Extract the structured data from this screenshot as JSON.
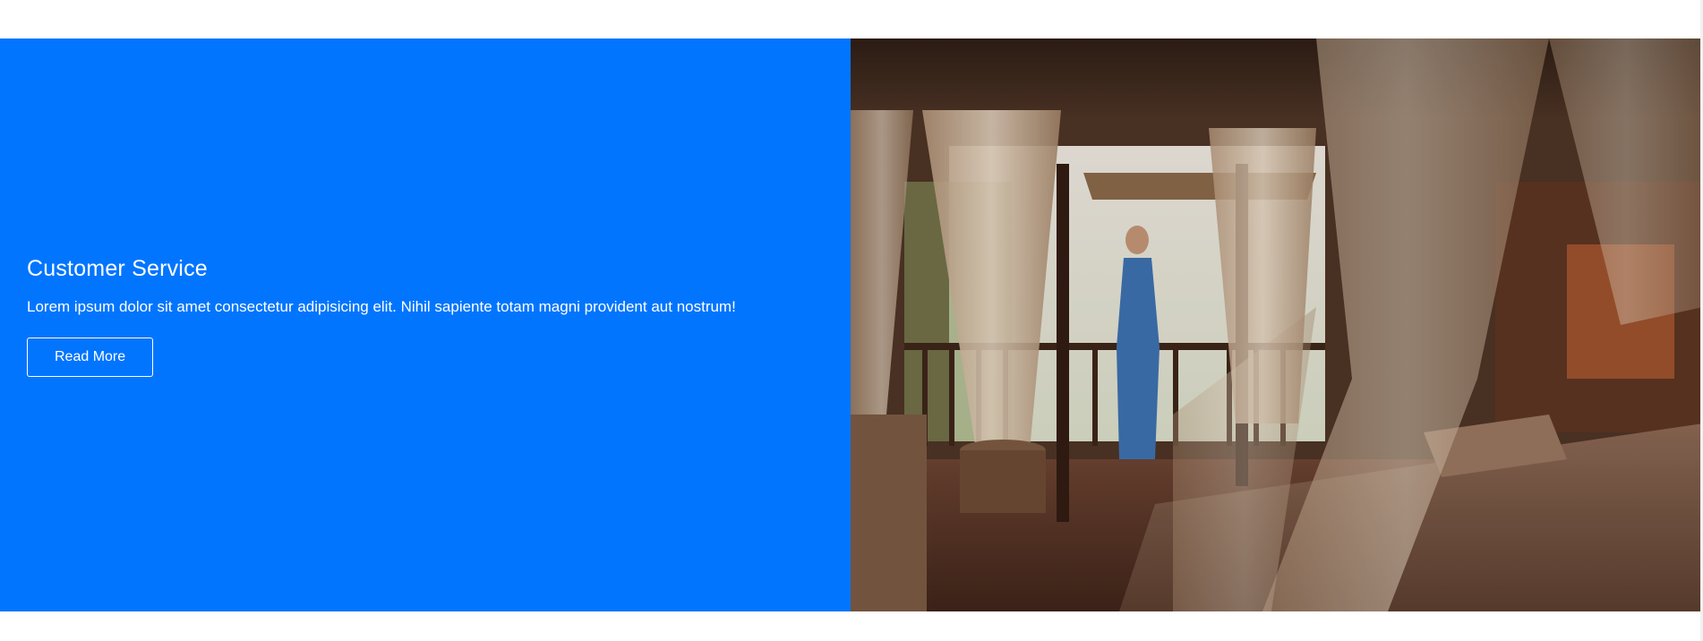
{
  "section": {
    "heading": "Customer Service",
    "description": "Lorem ipsum dolor sit amet consectetur adipisicing elit. Nihil sapiente totam magni provident aut nostrum!",
    "button_label": "Read More"
  },
  "photo": {
    "subject": "resort-room-balcony-image"
  },
  "colors": {
    "accent": "#0275ff",
    "text": "#ffffff",
    "background": "#ffffff"
  }
}
